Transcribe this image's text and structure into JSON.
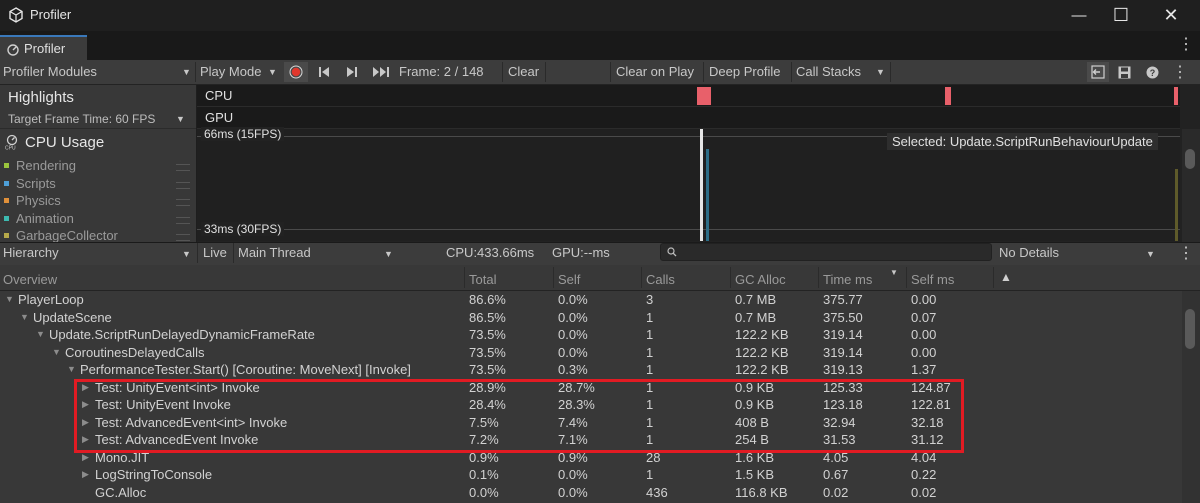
{
  "window": {
    "title": "Profiler",
    "minimize_icon": "—",
    "maximize_icon": "☐",
    "close_icon": "✕"
  },
  "tab": {
    "label": "Profiler"
  },
  "toolbar": {
    "modules_dropdown": "Profiler Modules",
    "play_mode": "Play Mode",
    "frame_label": "Frame: 2 / 148",
    "clear": "Clear",
    "clear_on_play": "Clear on Play",
    "deep_profile": "Deep Profile",
    "call_stacks": "Call Stacks"
  },
  "highlights": {
    "title": "Highlights",
    "target_frame_time": "Target Frame Time: 60 FPS",
    "cpu_lane": "CPU",
    "gpu_lane": "GPU"
  },
  "cpu_usage": {
    "title": "CPU Usage",
    "legend": [
      {
        "label": "Rendering",
        "color": "#9bc53d"
      },
      {
        "label": "Scripts",
        "color": "#4e9fd8"
      },
      {
        "label": "Physics",
        "color": "#e0903a"
      },
      {
        "label": "Animation",
        "color": "#3dbab0"
      },
      {
        "label": "GarbageCollector",
        "color": "#b6a94a"
      }
    ],
    "label_66": "66ms (15FPS)",
    "label_33": "33ms (30FPS)",
    "selected": "Selected: Update.ScriptRunBehaviourUpdate"
  },
  "hierarchy_toolbar": {
    "view": "Hierarchy",
    "live": "Live",
    "thread": "Main Thread",
    "cpu": "CPU:433.66ms",
    "gpu": "GPU:--ms",
    "details": "No Details"
  },
  "columns": [
    "Overview",
    "Total",
    "Self",
    "Calls",
    "GC Alloc",
    "Time ms",
    "Self ms"
  ],
  "rows": [
    {
      "name": "PlayerLoop",
      "total": "86.6%",
      "self": "0.0%",
      "calls": "3",
      "gc": "0.7 MB",
      "time": "375.77",
      "selfms": "0.00"
    },
    {
      "name": "UpdateScene",
      "total": "86.5%",
      "self": "0.0%",
      "calls": "1",
      "gc": "0.7 MB",
      "time": "375.50",
      "selfms": "0.07"
    },
    {
      "name": "Update.ScriptRunDelayedDynamicFrameRate",
      "total": "73.5%",
      "self": "0.0%",
      "calls": "1",
      "gc": "122.2 KB",
      "time": "319.14",
      "selfms": "0.00"
    },
    {
      "name": "CoroutinesDelayedCalls",
      "total": "73.5%",
      "self": "0.0%",
      "calls": "1",
      "gc": "122.2 KB",
      "time": "319.14",
      "selfms": "0.00"
    },
    {
      "name": "PerformanceTester.Start() [Coroutine: MoveNext] [Invoke]",
      "total": "73.5%",
      "self": "0.3%",
      "calls": "1",
      "gc": "122.2 KB",
      "time": "319.13",
      "selfms": "1.37"
    },
    {
      "name": "Test: UnityEvent<int> Invoke",
      "total": "28.9%",
      "self": "28.7%",
      "calls": "1",
      "gc": "0.9 KB",
      "time": "125.33",
      "selfms": "124.87"
    },
    {
      "name": "Test: UnityEvent Invoke",
      "total": "28.4%",
      "self": "28.3%",
      "calls": "1",
      "gc": "0.9 KB",
      "time": "123.18",
      "selfms": "122.81"
    },
    {
      "name": "Test: AdvancedEvent<int> Invoke",
      "total": "7.5%",
      "self": "7.4%",
      "calls": "1",
      "gc": "408 B",
      "time": "32.94",
      "selfms": "32.18"
    },
    {
      "name": "Test: AdvancedEvent Invoke",
      "total": "7.2%",
      "self": "7.1%",
      "calls": "1",
      "gc": "254 B",
      "time": "31.53",
      "selfms": "31.12"
    },
    {
      "name": "Mono.JIT",
      "total": "0.9%",
      "self": "0.9%",
      "calls": "28",
      "gc": "1.6 KB",
      "time": "4.05",
      "selfms": "4.04"
    },
    {
      "name": "LogStringToConsole",
      "total": "0.1%",
      "self": "0.0%",
      "calls": "1",
      "gc": "1.5 KB",
      "time": "0.67",
      "selfms": "0.22"
    },
    {
      "name": "GC.Alloc",
      "total": "0.0%",
      "self": "0.0%",
      "calls": "436",
      "gc": "116.8 KB",
      "time": "0.02",
      "selfms": "0.02"
    }
  ]
}
